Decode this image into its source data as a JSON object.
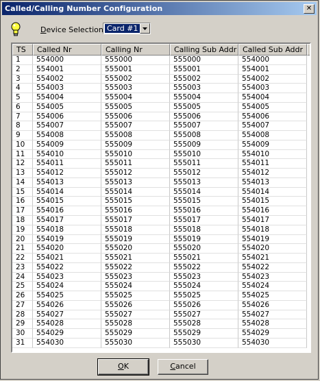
{
  "window": {
    "title": "Called/Calling Number Configuration"
  },
  "toolbar": {
    "device_label_prefix": "",
    "device_label_hot": "D",
    "device_label_rest": "evice Selection",
    "device_value": "Card #1"
  },
  "table": {
    "columns": [
      "TS",
      "Called Nr",
      "Calling Nr",
      "Calling Sub Addr",
      "Called Sub Addr"
    ],
    "rows": [
      [
        "1",
        "554000",
        "555000",
        "555000",
        "554000"
      ],
      [
        "2",
        "554001",
        "555001",
        "555001",
        "554001"
      ],
      [
        "3",
        "554002",
        "555002",
        "555002",
        "554002"
      ],
      [
        "4",
        "554003",
        "555003",
        "555003",
        "554003"
      ],
      [
        "5",
        "554004",
        "555004",
        "555004",
        "554004"
      ],
      [
        "6",
        "554005",
        "555005",
        "555005",
        "554005"
      ],
      [
        "7",
        "554006",
        "555006",
        "555006",
        "554006"
      ],
      [
        "8",
        "554007",
        "555007",
        "555007",
        "554007"
      ],
      [
        "9",
        "554008",
        "555008",
        "555008",
        "554008"
      ],
      [
        "10",
        "554009",
        "555009",
        "555009",
        "554009"
      ],
      [
        "11",
        "554010",
        "555010",
        "555010",
        "554010"
      ],
      [
        "12",
        "554011",
        "555011",
        "555011",
        "554011"
      ],
      [
        "13",
        "554012",
        "555012",
        "555012",
        "554012"
      ],
      [
        "14",
        "554013",
        "555013",
        "555013",
        "554013"
      ],
      [
        "15",
        "554014",
        "555014",
        "555014",
        "554014"
      ],
      [
        "16",
        "554015",
        "555015",
        "555015",
        "554015"
      ],
      [
        "17",
        "554016",
        "555016",
        "555016",
        "554016"
      ],
      [
        "18",
        "554017",
        "555017",
        "555017",
        "554017"
      ],
      [
        "19",
        "554018",
        "555018",
        "555018",
        "554018"
      ],
      [
        "20",
        "554019",
        "555019",
        "555019",
        "554019"
      ],
      [
        "21",
        "554020",
        "555020",
        "555020",
        "554020"
      ],
      [
        "22",
        "554021",
        "555021",
        "555021",
        "554021"
      ],
      [
        "23",
        "554022",
        "555022",
        "555022",
        "554022"
      ],
      [
        "24",
        "554023",
        "555023",
        "555023",
        "554023"
      ],
      [
        "25",
        "554024",
        "555024",
        "555024",
        "554024"
      ],
      [
        "26",
        "554025",
        "555025",
        "555025",
        "554025"
      ],
      [
        "27",
        "554026",
        "555026",
        "555026",
        "554026"
      ],
      [
        "28",
        "554027",
        "555027",
        "555027",
        "554027"
      ],
      [
        "29",
        "554028",
        "555028",
        "555028",
        "554028"
      ],
      [
        "30",
        "554029",
        "555029",
        "555029",
        "554029"
      ],
      [
        "31",
        "554030",
        "555030",
        "555030",
        "554030"
      ]
    ]
  },
  "buttons": {
    "ok_hot": "O",
    "ok_rest": "K",
    "cancel_hot": "C",
    "cancel_rest": "ancel"
  },
  "icons": {
    "close": "close-icon",
    "bulb": "lightbulb-icon",
    "dropdown": "chevron-down-icon"
  },
  "colors": {
    "title_start": "#0a246a",
    "title_end": "#a6caf0",
    "face": "#d4d0c8",
    "selection": "#0a246a"
  }
}
